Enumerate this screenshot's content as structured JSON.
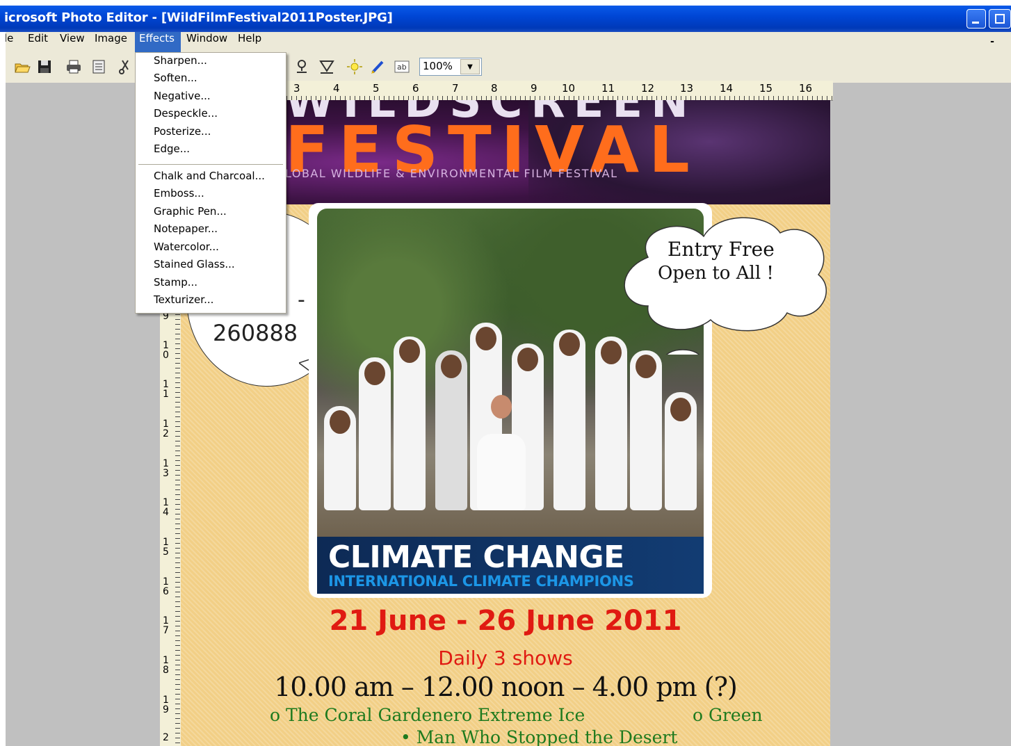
{
  "window": {
    "title": "icrosoft Photo Editor - [WildFilmFestival2011Poster.JPG]"
  },
  "menubar": {
    "items": [
      "le",
      "Edit",
      "View",
      "Image",
      "Effects",
      "Window",
      "Help"
    ],
    "active": "Effects",
    "mdi_minimize": "-"
  },
  "toolbar": {
    "icons": [
      "open-icon",
      "save-icon",
      "print-icon",
      "print-preview-icon",
      "cut-icon",
      "stamp-icon",
      "filter-icon",
      "brightness-icon",
      "pen-icon",
      "text-icon"
    ],
    "zoom_value": "100%"
  },
  "effects_menu": {
    "group1": [
      "Sharpen...",
      "Soften...",
      "Negative...",
      "Despeckle...",
      "Posterize...",
      "Edge..."
    ],
    "group2": [
      "Chalk and Charcoal...",
      "Emboss...",
      "Graphic Pen...",
      "Notepaper...",
      "Watercolor...",
      "Stained Glass...",
      "Stamp...",
      "Texturizer..."
    ]
  },
  "rulers": {
    "top_numbers": [
      "3",
      "4",
      "5",
      "6",
      "7",
      "8",
      "9",
      "10",
      "11",
      "12",
      "13",
      "14",
      "15",
      "16"
    ],
    "left_numbers": [
      "9",
      "10",
      "11",
      "12",
      "13",
      "14",
      "15",
      "16",
      "17",
      "18",
      "19",
      "2"
    ]
  },
  "poster": {
    "header_top": "WILDSCREEN",
    "header_main": "FESTIVAL",
    "header_subtitle": "LOBAL WILDLIFE & ENVIRONMENTAL FILM FESTIVAL",
    "speech_number": "260888",
    "speech_dash": "-",
    "cloud_line1": "Entry Free",
    "cloud_line2": "Open to All !",
    "banner_title": "CLIMATE CHANGE",
    "banner_subtitle": "INTERNATIONAL CLIMATE CHAMPIONS",
    "dates": "21 June - 26 June 2011",
    "daily": "Daily 3 shows",
    "times": "10.00 am – 12.00 noon – 4.00 pm (?)",
    "films": [
      "o  The Coral Gardener",
      "o  Extreme Ice",
      "o  Green",
      "•  Man Who Stopped the Desert"
    ]
  },
  "colors": {
    "title_bar": "#0046d5",
    "menu_highlight": "#316ac5",
    "poster_bg": "#f2cf86",
    "date_red": "#e01a12",
    "film_green": "#1e7a1e"
  }
}
